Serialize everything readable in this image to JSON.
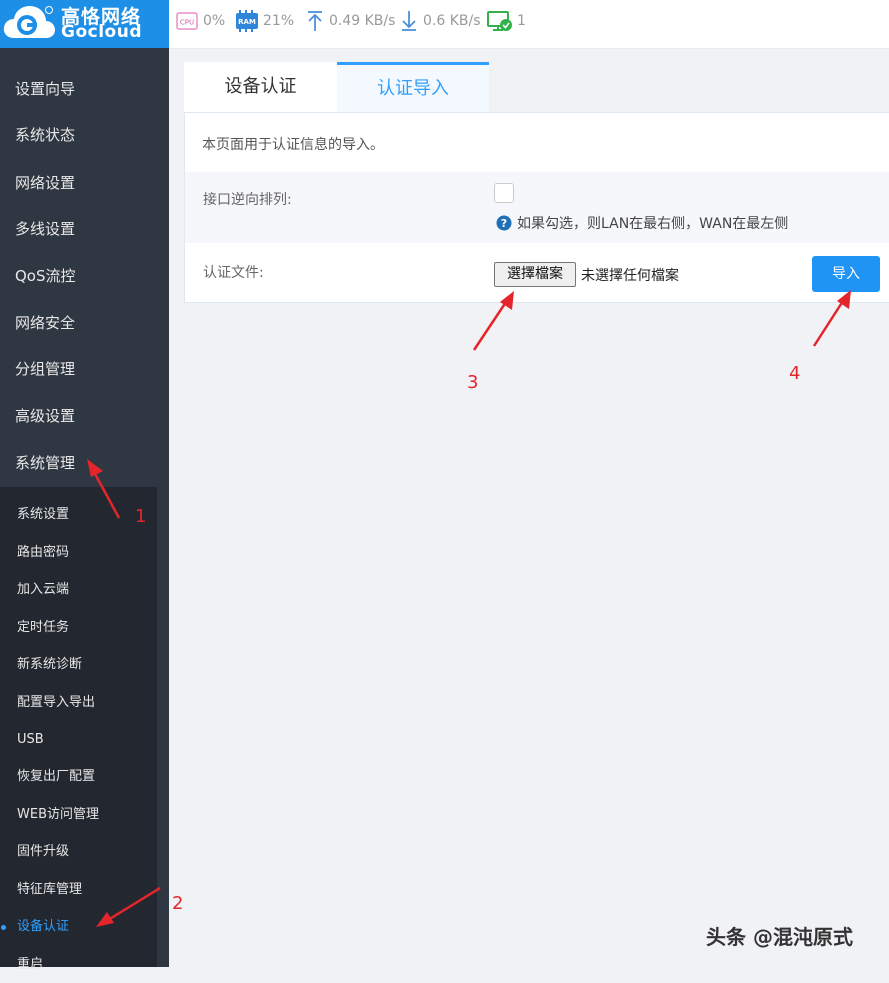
{
  "brand": {
    "name_cn": "高恪网络",
    "name_en": "Gocloud"
  },
  "topbar": {
    "cpu": {
      "icon": "cpu-icon",
      "value": "0%"
    },
    "ram": {
      "icon": "ram-icon",
      "value": "21%"
    },
    "upload": {
      "icon": "upload-arrow-icon",
      "value": "0.49 KB/s"
    },
    "download": {
      "icon": "download-arrow-icon",
      "value": "0.6 KB/s"
    },
    "devices": {
      "icon": "monitor-check-icon",
      "value": "1"
    }
  },
  "sidebar": {
    "items": [
      "设置向导",
      "系统状态",
      "网络设置",
      "多线设置",
      "QoS流控",
      "网络安全",
      "分组管理",
      "高级设置",
      "系统管理"
    ],
    "subitems": [
      "系统设置",
      "路由密码",
      "加入云端",
      "定时任务",
      "新系统诊断",
      "配置导入导出",
      "USB",
      "恢复出厂配置",
      "WEB访问管理",
      "固件升级",
      "特征库管理",
      "设备认证",
      "重启"
    ],
    "active_subitem_index": 11
  },
  "tabs": [
    {
      "label": "设备认证",
      "active": false
    },
    {
      "label": "认证导入",
      "active": true
    }
  ],
  "panel": {
    "description": "本页面用于认证信息的导入。",
    "reverse_label": "接口逆向排列:",
    "reverse_checked": false,
    "reverse_hint": "如果勾选，则LAN在最右侧，WAN在最左侧",
    "file_label": "认证文件:",
    "file_button": "選擇檔案",
    "file_status": "未選擇任何檔案",
    "import_button": "导入"
  },
  "annotations": [
    "1",
    "2",
    "3",
    "4"
  ],
  "watermark": "头条 @混沌原式",
  "colors": {
    "brand": "#1e8fe6",
    "accent": "#2fa0ff",
    "sidebar": "#2f3742",
    "annotation": "#e4252b"
  }
}
